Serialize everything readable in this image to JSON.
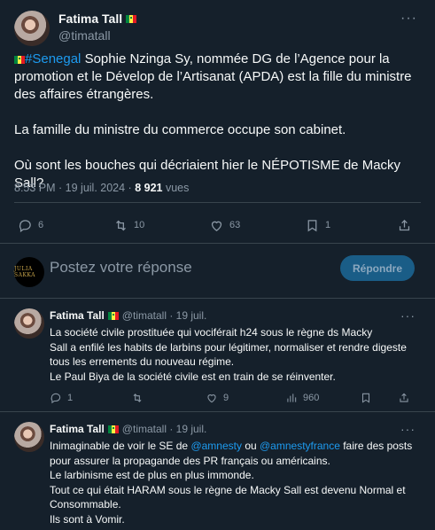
{
  "main_tweet": {
    "display_name": "Fatima Tall",
    "handle": "@timatall",
    "more": "···",
    "hashtag": "#Senegal",
    "line1_rest": " Sophie Nzinga Sy, nommée DG de l’Agence pour la promotion et le Dévelop de l’Artisanat (APDA) est la fille du ministre des affaires étrangères.",
    "para2": "La famille du ministre du commerce occupe son cabinet.",
    "para3": "Où sont les bouches qui décriaient hier le NÉPOTISME de Macky Sall?",
    "time": "8:53 PM · 19 juil. 2024 · ",
    "views_count": "8 921",
    "views_label": " vues",
    "stats": {
      "replies": "6",
      "reposts": "10",
      "likes": "63",
      "bookmarks": "1"
    }
  },
  "reply_box": {
    "avatar_text": "JULIA SAKKA",
    "placeholder": "Postez votre réponse",
    "button": "Répondre"
  },
  "replies": [
    {
      "display_name": "Fatima Tall",
      "handle_date": "@timatall · 19 juil.",
      "more": "···",
      "lines": [
        "La société civile prostituée qui vociférait h24 sous le règne ds Macky",
        "Sall a enfilé les habits de larbins pour légitimer, normaliser et rendre digeste",
        "tous les errements du nouveau régime.",
        "Le Paul Biya de la société civile est en train de se réinventer."
      ],
      "stats": {
        "replies": "1",
        "reposts": "",
        "likes": "9",
        "views": "960"
      }
    },
    {
      "display_name": "Fatima Tall",
      "handle_date": "@timatall · 19 juil.",
      "more": "···",
      "line1_a": "Inimaginable de voir le SE de ",
      "mention1": "@amnesty",
      "line1_b": " ou ",
      "mention2": "@amnestyfrance",
      "line1_c": " faire des posts",
      "lines": [
        "pour assurer la propagande des PR français ou américains.",
        "Le larbinisme est de plus en plus immonde.",
        "Tout ce qui était HARAM sous le règne de Macky Sall est devenu Normal et",
        "Consommable.",
        "Ils sont à Vomir."
      ]
    }
  ],
  "colors": {
    "background": "#15202b",
    "text": "#f7f9f9",
    "muted": "#8b98a5",
    "accent": "#1d9bf0",
    "divider": "#38444d"
  },
  "icons": [
    "reply-icon",
    "repost-icon",
    "like-icon",
    "bookmark-icon",
    "share-icon",
    "views-icon",
    "senegal-flag-icon"
  ]
}
